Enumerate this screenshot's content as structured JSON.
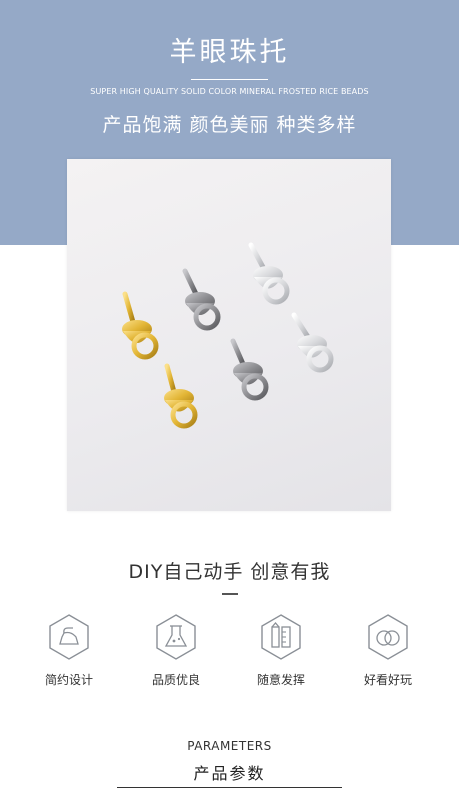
{
  "header": {
    "title": "羊眼珠托",
    "subtitle_en": "SUPER HIGH QUALITY SOLID COLOR MINERAL FROSTED RICE BEADS",
    "tagline": "产品饱满 颜色美丽 种类多样"
  },
  "slogan": "DIY自己动手 创意有我",
  "features": [
    {
      "label": "简约设计",
      "icon": "iron-icon"
    },
    {
      "label": "品质优良",
      "icon": "flask-icon"
    },
    {
      "label": "随意发挥",
      "icon": "ruler-pencil-icon"
    },
    {
      "label": "好看好玩",
      "icon": "rings-icon"
    }
  ],
  "parameters": {
    "heading_en": "PARAMETERS",
    "heading_cn": "产品参数"
  },
  "colors": {
    "banner": "#95a9c7",
    "icon_stroke": "#8a8f96",
    "gold": "#e2b535",
    "gunmetal": "#8e8e92",
    "silver": "#d8d9dc"
  }
}
